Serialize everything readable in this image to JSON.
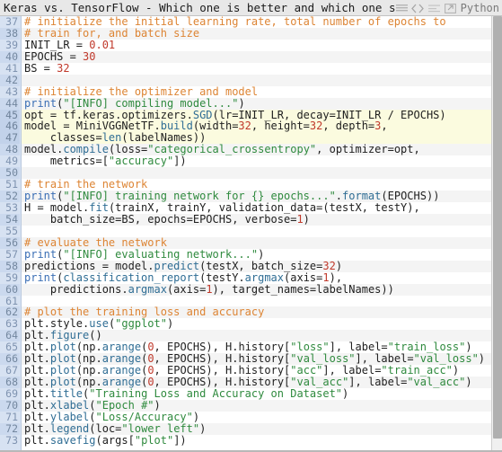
{
  "window": {
    "title": "Keras vs. TensorFlow - Which one is better and which one s",
    "language_label": "Python"
  },
  "toolbar": {
    "icons": [
      {
        "name": "lines-icon",
        "label": "Wrap lines"
      },
      {
        "name": "code-brackets-icon",
        "label": "View source"
      },
      {
        "name": "list-icon",
        "label": "Toggle list"
      },
      {
        "name": "popout-icon",
        "label": "Open in new window"
      }
    ]
  },
  "scrollbar": {
    "orientation": "vertical",
    "position": "right"
  },
  "editor": {
    "language": "python",
    "first_line_number": 37,
    "highlighted_lines": [
      45,
      46,
      47
    ],
    "colors": {
      "gutter_bg": "#d7e2f2",
      "gutter_bg_alt": "#cbd9ee",
      "gutter_text": "#7f93b0",
      "row_bg": "#ffffff",
      "row_bg_alt": "#f4f4f4",
      "highlight_bg": "#fbfbdf",
      "comment": "#dd8433",
      "string": "#2f8a3e",
      "number": "#c0392b",
      "function": "#3b6fb5",
      "attribute": "#2f6d94",
      "plain": "#202020"
    },
    "lines": [
      {
        "n": 37,
        "tokens": [
          {
            "t": "com",
            "s": "# initialize the initial learning rate, total number of epochs to"
          }
        ]
      },
      {
        "n": 38,
        "tokens": [
          {
            "t": "com",
            "s": "# train for, and batch size"
          }
        ]
      },
      {
        "n": 39,
        "tokens": [
          {
            "t": "id",
            "s": "INIT_LR = "
          },
          {
            "t": "num",
            "s": "0.01"
          }
        ]
      },
      {
        "n": 40,
        "tokens": [
          {
            "t": "id",
            "s": "EPOCHS = "
          },
          {
            "t": "num",
            "s": "30"
          }
        ]
      },
      {
        "n": 41,
        "tokens": [
          {
            "t": "id",
            "s": "BS = "
          },
          {
            "t": "num",
            "s": "32"
          }
        ]
      },
      {
        "n": 42,
        "tokens": []
      },
      {
        "n": 43,
        "tokens": [
          {
            "t": "com",
            "s": "# initialize the optimizer and model"
          }
        ]
      },
      {
        "n": 44,
        "tokens": [
          {
            "t": "fn",
            "s": "print"
          },
          {
            "t": "id",
            "s": "("
          },
          {
            "t": "str",
            "s": "\"[INFO] compiling model...\""
          },
          {
            "t": "id",
            "s": ")"
          }
        ]
      },
      {
        "n": 45,
        "tokens": [
          {
            "t": "id",
            "s": "opt = tf.keras.optimizers."
          },
          {
            "t": "attr",
            "s": "SGD"
          },
          {
            "t": "id",
            "s": "(lr=INIT_LR, decay=INIT_LR / EPOCHS)"
          }
        ]
      },
      {
        "n": 46,
        "tokens": [
          {
            "t": "id",
            "s": "model = MiniVGGNetTF."
          },
          {
            "t": "attr",
            "s": "build"
          },
          {
            "t": "id",
            "s": "(width="
          },
          {
            "t": "num",
            "s": "32"
          },
          {
            "t": "id",
            "s": ", height="
          },
          {
            "t": "num",
            "s": "32"
          },
          {
            "t": "id",
            "s": ", depth="
          },
          {
            "t": "num",
            "s": "3"
          },
          {
            "t": "id",
            "s": ","
          }
        ]
      },
      {
        "n": 47,
        "tokens": [
          {
            "t": "id",
            "s": "    classes="
          },
          {
            "t": "attr",
            "s": "len"
          },
          {
            "t": "id",
            "s": "(labelNames))"
          }
        ]
      },
      {
        "n": 48,
        "tokens": [
          {
            "t": "id",
            "s": "model."
          },
          {
            "t": "attr",
            "s": "compile"
          },
          {
            "t": "id",
            "s": "(loss="
          },
          {
            "t": "str",
            "s": "\"categorical_crossentropy\""
          },
          {
            "t": "id",
            "s": ", optimizer=opt,"
          }
        ]
      },
      {
        "n": 49,
        "tokens": [
          {
            "t": "id",
            "s": "    metrics=["
          },
          {
            "t": "str",
            "s": "\"accuracy\""
          },
          {
            "t": "id",
            "s": "])"
          }
        ]
      },
      {
        "n": 50,
        "tokens": []
      },
      {
        "n": 51,
        "tokens": [
          {
            "t": "com",
            "s": "# train the network"
          }
        ]
      },
      {
        "n": 52,
        "tokens": [
          {
            "t": "fn",
            "s": "print"
          },
          {
            "t": "id",
            "s": "("
          },
          {
            "t": "str",
            "s": "\"[INFO] training network for {} epochs...\""
          },
          {
            "t": "id",
            "s": "."
          },
          {
            "t": "attr",
            "s": "format"
          },
          {
            "t": "id",
            "s": "(EPOCHS))"
          }
        ]
      },
      {
        "n": 53,
        "tokens": [
          {
            "t": "id",
            "s": "H = model."
          },
          {
            "t": "attr",
            "s": "fit"
          },
          {
            "t": "id",
            "s": "(trainX, trainY, validation_data=(testX, testY),"
          }
        ]
      },
      {
        "n": 54,
        "tokens": [
          {
            "t": "id",
            "s": "    batch_size=BS, epochs=EPOCHS, verbose="
          },
          {
            "t": "num",
            "s": "1"
          },
          {
            "t": "id",
            "s": ")"
          }
        ]
      },
      {
        "n": 55,
        "tokens": []
      },
      {
        "n": 56,
        "tokens": [
          {
            "t": "com",
            "s": "# evaluate the network"
          }
        ]
      },
      {
        "n": 57,
        "tokens": [
          {
            "t": "fn",
            "s": "print"
          },
          {
            "t": "id",
            "s": "("
          },
          {
            "t": "str",
            "s": "\"[INFO] evaluating network...\""
          },
          {
            "t": "id",
            "s": ")"
          }
        ]
      },
      {
        "n": 58,
        "tokens": [
          {
            "t": "id",
            "s": "predictions = model."
          },
          {
            "t": "attr",
            "s": "predict"
          },
          {
            "t": "id",
            "s": "(testX, batch_size="
          },
          {
            "t": "num",
            "s": "32"
          },
          {
            "t": "id",
            "s": ")"
          }
        ]
      },
      {
        "n": 59,
        "tokens": [
          {
            "t": "fn",
            "s": "print"
          },
          {
            "t": "id",
            "s": "("
          },
          {
            "t": "attr",
            "s": "classification_report"
          },
          {
            "t": "id",
            "s": "(testY."
          },
          {
            "t": "attr",
            "s": "argmax"
          },
          {
            "t": "id",
            "s": "(axis="
          },
          {
            "t": "num",
            "s": "1"
          },
          {
            "t": "id",
            "s": "),"
          }
        ]
      },
      {
        "n": 60,
        "tokens": [
          {
            "t": "id",
            "s": "    predictions."
          },
          {
            "t": "attr",
            "s": "argmax"
          },
          {
            "t": "id",
            "s": "(axis="
          },
          {
            "t": "num",
            "s": "1"
          },
          {
            "t": "id",
            "s": "), target_names=labelNames))"
          }
        ]
      },
      {
        "n": 61,
        "tokens": []
      },
      {
        "n": 62,
        "tokens": [
          {
            "t": "com",
            "s": "# plot the training loss and accuracy"
          }
        ]
      },
      {
        "n": 63,
        "tokens": [
          {
            "t": "id",
            "s": "plt.style."
          },
          {
            "t": "attr",
            "s": "use"
          },
          {
            "t": "id",
            "s": "("
          },
          {
            "t": "str",
            "s": "\"ggplot\""
          },
          {
            "t": "id",
            "s": ")"
          }
        ]
      },
      {
        "n": 64,
        "tokens": [
          {
            "t": "id",
            "s": "plt."
          },
          {
            "t": "attr",
            "s": "figure"
          },
          {
            "t": "id",
            "s": "()"
          }
        ]
      },
      {
        "n": 65,
        "tokens": [
          {
            "t": "id",
            "s": "plt."
          },
          {
            "t": "attr",
            "s": "plot"
          },
          {
            "t": "id",
            "s": "(np."
          },
          {
            "t": "attr",
            "s": "arange"
          },
          {
            "t": "id",
            "s": "("
          },
          {
            "t": "num",
            "s": "0"
          },
          {
            "t": "id",
            "s": ", EPOCHS), H.history["
          },
          {
            "t": "str",
            "s": "\"loss\""
          },
          {
            "t": "id",
            "s": "], label="
          },
          {
            "t": "str",
            "s": "\"train_loss\""
          },
          {
            "t": "id",
            "s": ")"
          }
        ]
      },
      {
        "n": 66,
        "tokens": [
          {
            "t": "id",
            "s": "plt."
          },
          {
            "t": "attr",
            "s": "plot"
          },
          {
            "t": "id",
            "s": "(np."
          },
          {
            "t": "attr",
            "s": "arange"
          },
          {
            "t": "id",
            "s": "("
          },
          {
            "t": "num",
            "s": "0"
          },
          {
            "t": "id",
            "s": ", EPOCHS), H.history["
          },
          {
            "t": "str",
            "s": "\"val_loss\""
          },
          {
            "t": "id",
            "s": "], label="
          },
          {
            "t": "str",
            "s": "\"val_loss\""
          },
          {
            "t": "id",
            "s": ")"
          }
        ]
      },
      {
        "n": 67,
        "tokens": [
          {
            "t": "id",
            "s": "plt."
          },
          {
            "t": "attr",
            "s": "plot"
          },
          {
            "t": "id",
            "s": "(np."
          },
          {
            "t": "attr",
            "s": "arange"
          },
          {
            "t": "id",
            "s": "("
          },
          {
            "t": "num",
            "s": "0"
          },
          {
            "t": "id",
            "s": ", EPOCHS), H.history["
          },
          {
            "t": "str",
            "s": "\"acc\""
          },
          {
            "t": "id",
            "s": "], label="
          },
          {
            "t": "str",
            "s": "\"train_acc\""
          },
          {
            "t": "id",
            "s": ")"
          }
        ]
      },
      {
        "n": 68,
        "tokens": [
          {
            "t": "id",
            "s": "plt."
          },
          {
            "t": "attr",
            "s": "plot"
          },
          {
            "t": "id",
            "s": "(np."
          },
          {
            "t": "attr",
            "s": "arange"
          },
          {
            "t": "id",
            "s": "("
          },
          {
            "t": "num",
            "s": "0"
          },
          {
            "t": "id",
            "s": ", EPOCHS), H.history["
          },
          {
            "t": "str",
            "s": "\"val_acc\""
          },
          {
            "t": "id",
            "s": "], label="
          },
          {
            "t": "str",
            "s": "\"val_acc\""
          },
          {
            "t": "id",
            "s": ")"
          }
        ]
      },
      {
        "n": 69,
        "tokens": [
          {
            "t": "id",
            "s": "plt."
          },
          {
            "t": "attr",
            "s": "title"
          },
          {
            "t": "id",
            "s": "("
          },
          {
            "t": "str",
            "s": "\"Training Loss and Accuracy on Dataset\""
          },
          {
            "t": "id",
            "s": ")"
          }
        ]
      },
      {
        "n": 70,
        "tokens": [
          {
            "t": "id",
            "s": "plt."
          },
          {
            "t": "attr",
            "s": "xlabel"
          },
          {
            "t": "id",
            "s": "("
          },
          {
            "t": "str",
            "s": "\"Epoch #\""
          },
          {
            "t": "id",
            "s": ")"
          }
        ]
      },
      {
        "n": 71,
        "tokens": [
          {
            "t": "id",
            "s": "plt."
          },
          {
            "t": "attr",
            "s": "ylabel"
          },
          {
            "t": "id",
            "s": "("
          },
          {
            "t": "str",
            "s": "\"Loss/Accuracy\""
          },
          {
            "t": "id",
            "s": ")"
          }
        ]
      },
      {
        "n": 72,
        "tokens": [
          {
            "t": "id",
            "s": "plt."
          },
          {
            "t": "attr",
            "s": "legend"
          },
          {
            "t": "id",
            "s": "(loc="
          },
          {
            "t": "str",
            "s": "\"lower left\""
          },
          {
            "t": "id",
            "s": ")"
          }
        ]
      },
      {
        "n": 73,
        "tokens": [
          {
            "t": "id",
            "s": "plt."
          },
          {
            "t": "attr",
            "s": "savefig"
          },
          {
            "t": "id",
            "s": "(args["
          },
          {
            "t": "str",
            "s": "\"plot\""
          },
          {
            "t": "id",
            "s": "])"
          }
        ]
      }
    ]
  }
}
